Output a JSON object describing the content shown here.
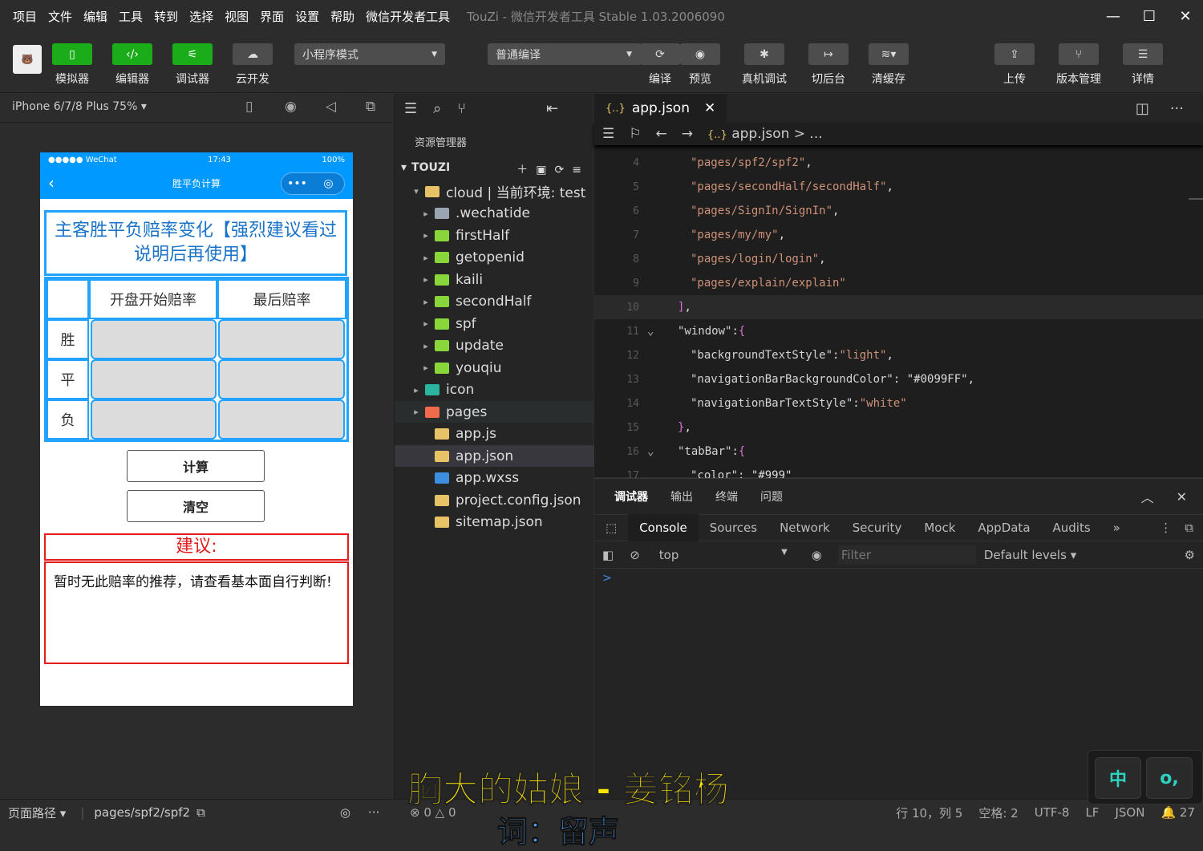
{
  "menu": [
    "项目",
    "文件",
    "编辑",
    "工具",
    "转到",
    "选择",
    "视图",
    "界面",
    "设置",
    "帮助",
    "微信开发者工具"
  ],
  "window_title": "TouZi - 微信开发者工具 Stable 1.03.2006090",
  "window_controls": {
    "minimize": "—",
    "maximize": "☐",
    "close": "✕"
  },
  "toolbar": {
    "simulator": "模拟器",
    "editor": "编辑器",
    "debugger": "调试器",
    "cloud": "云开发",
    "mode_select": "小程序模式",
    "compile_select": "普通编译",
    "compile": "编译",
    "preview": "预览",
    "remote_debug": "真机调试",
    "background": "切后台",
    "clear_cache": "清缓存",
    "upload": "上传",
    "version": "版本管理",
    "details": "详情"
  },
  "simulator": {
    "device": "iPhone 6/7/8 Plus 75%",
    "status_left": "●●●●● WeChat",
    "status_time": "17:43",
    "status_right": "100%",
    "nav_title": "胜平负计算",
    "capsule_more": "•••",
    "capsule_close": "◎",
    "heading": "主客胜平负赔率变化【强烈建议看过说明后再使用】",
    "col_open": "开盘开始赔率",
    "col_last": "最后赔率",
    "row_win": "胜",
    "row_draw": "平",
    "row_lose": "负",
    "btn_calc": "计算",
    "btn_clear": "清空",
    "suggest_label": "建议:",
    "suggest_text": "暂时无此赔率的推荐，请查看基本面自行判断!",
    "footer_path_label": "页面路径",
    "footer_path": "pages/spf2/spf2"
  },
  "explorer": {
    "title": "资源管理器",
    "project": "TOUZI",
    "tree": [
      {
        "label": "cloud | 当前环境: test",
        "icon": "folder-open-icon",
        "color": "#e8c267"
      },
      {
        "label": ".wechatide",
        "icon": "folder-icon",
        "color": "#9aa5b1"
      },
      {
        "label": "firstHalf",
        "icon": "cloud-folder-icon",
        "color": "#89d63a"
      },
      {
        "label": "getopenid",
        "icon": "cloud-folder-icon",
        "color": "#89d63a"
      },
      {
        "label": "kaili",
        "icon": "cloud-folder-icon",
        "color": "#89d63a"
      },
      {
        "label": "secondHalf",
        "icon": "cloud-folder-icon",
        "color": "#89d63a"
      },
      {
        "label": "spf",
        "icon": "cloud-folder-icon",
        "color": "#89d63a"
      },
      {
        "label": "update",
        "icon": "cloud-folder-icon",
        "color": "#89d63a"
      },
      {
        "label": "youqiu",
        "icon": "cloud-folder-icon",
        "color": "#89d63a"
      },
      {
        "label": "icon",
        "icon": "image-folder-icon",
        "color": "#2bb5a0"
      },
      {
        "label": "pages",
        "icon": "pages-folder-icon",
        "color": "#f06a4b"
      },
      {
        "label": "app.js",
        "icon": "js-file-icon",
        "color": "#e8c267"
      },
      {
        "label": "app.json",
        "icon": "json-file-icon",
        "color": "#e8c267"
      },
      {
        "label": "app.wxss",
        "icon": "wxss-file-icon",
        "color": "#3e8ee0"
      },
      {
        "label": "project.config.json",
        "icon": "json-file-icon",
        "color": "#e8c267"
      },
      {
        "label": "sitemap.json",
        "icon": "json-file-icon",
        "color": "#e8c267"
      }
    ]
  },
  "editor": {
    "tab": "app.json",
    "breadcrumb": "app.json > ...",
    "lines": [
      {
        "n": "4",
        "text": "\"pages/spf2/spf2\","
      },
      {
        "n": "5",
        "text": "\"pages/secondHalf/secondHalf\","
      },
      {
        "n": "6",
        "text": "\"pages/SignIn/SignIn\","
      },
      {
        "n": "7",
        "text": "\"pages/my/my\","
      },
      {
        "n": "8",
        "text": "\"pages/login/login\","
      },
      {
        "n": "9",
        "text": "\"pages/explain/explain\""
      },
      {
        "n": "10",
        "text": "],"
      },
      {
        "n": "11",
        "text": "\"window\":{"
      },
      {
        "n": "12",
        "text": "\"backgroundTextStyle\":\"light\","
      },
      {
        "n": "13",
        "text": "\"navigationBarBackgroundColor\": \"#0099FF\","
      },
      {
        "n": "14",
        "text": "\"navigationBarTextStyle\":\"white\""
      },
      {
        "n": "15",
        "text": "},"
      },
      {
        "n": "16",
        "text": "\"tabBar\":{"
      },
      {
        "n": "17",
        "text": "\"color\": \"#999\""
      }
    ]
  },
  "devtools": {
    "panels": [
      "调试器",
      "输出",
      "终端",
      "问题"
    ],
    "tabs": [
      "Console",
      "Sources",
      "Network",
      "Security",
      "Mock",
      "AppData",
      "Audits"
    ],
    "more": "»",
    "context": "top",
    "filter_placeholder": "Filter",
    "levels": "Default levels",
    "prompt": ">"
  },
  "statusbar": {
    "errors": "0",
    "warnings": "0",
    "position": "行 10，列 5",
    "spaces": "空格: 2",
    "encoding": "UTF-8",
    "eol": "LF",
    "language": "JSON",
    "notifications": "27"
  },
  "overlay": {
    "lyric_line1": "胸大的姑娘 - 姜铭杨",
    "lyric_line2": "词：留声",
    "ime_key1": "中",
    "ime_key2": "o,"
  },
  "colors": {
    "accent_blue": "#0099FF",
    "wechat_green": "#1aad19",
    "suggest_red": "#e31b1b"
  }
}
